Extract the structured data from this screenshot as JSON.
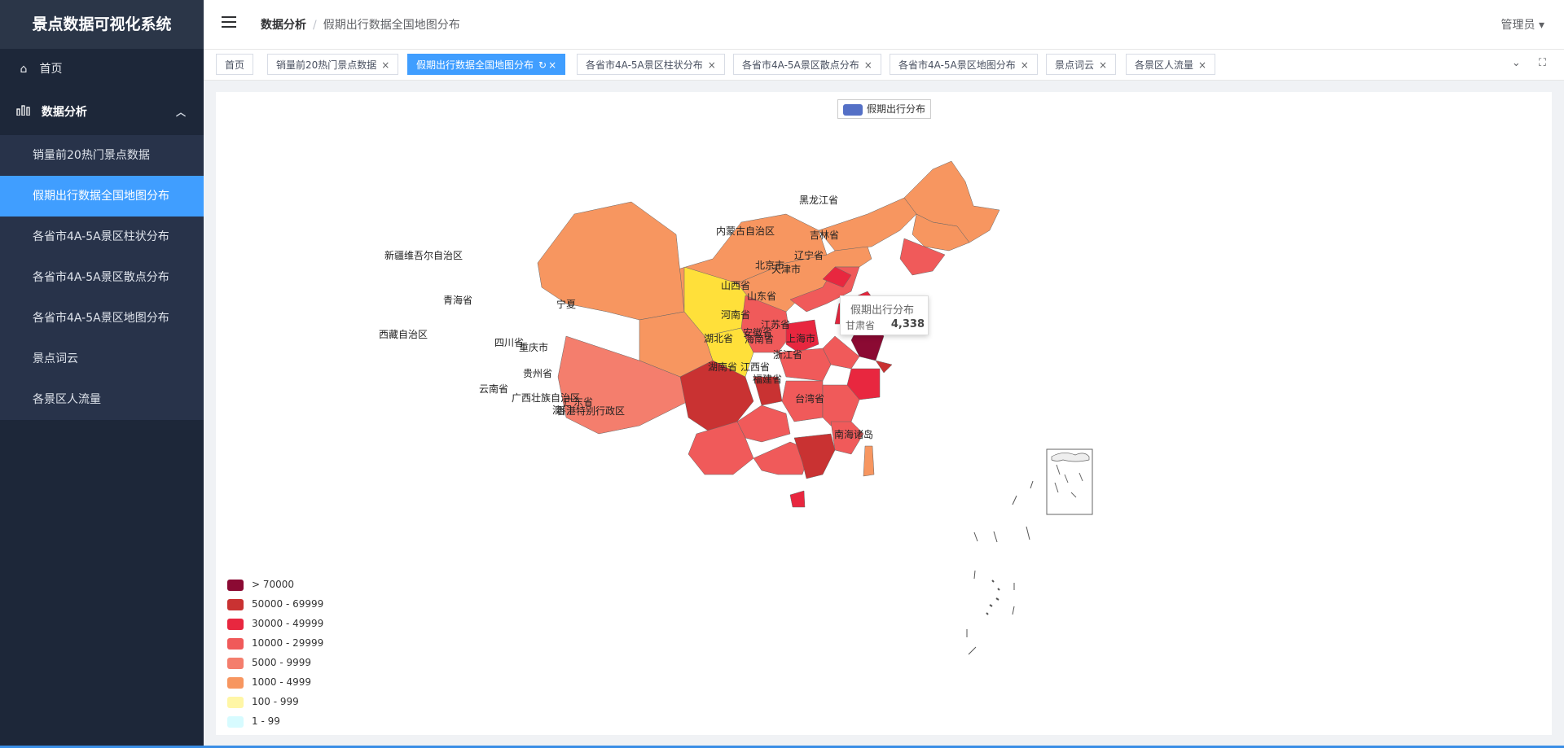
{
  "app": {
    "title": "景点数据可视化系统"
  },
  "sidebar": {
    "home": "首页",
    "group": "数据分析",
    "items": [
      {
        "label": "销量前20热门景点数据"
      },
      {
        "label": "假期出行数据全国地图分布"
      },
      {
        "label": "各省市4A-5A景区柱状分布"
      },
      {
        "label": "各省市4A-5A景区散点分布"
      },
      {
        "label": "各省市4A-5A景区地图分布"
      },
      {
        "label": "景点词云"
      },
      {
        "label": "各景区人流量"
      }
    ]
  },
  "header": {
    "breadcrumb_1": "数据分析",
    "breadcrumb_2": "假期出行数据全国地图分布",
    "user": "管理员"
  },
  "tags": [
    {
      "label": "首页"
    },
    {
      "label": "销量前20热门景点数据"
    },
    {
      "label": "假期出行数据全国地图分布"
    },
    {
      "label": "各省市4A-5A景区柱状分布"
    },
    {
      "label": "各省市4A-5A景区散点分布"
    },
    {
      "label": "各省市4A-5A景区地图分布"
    },
    {
      "label": "景点词云"
    },
    {
      "label": "各景区人流量"
    }
  ],
  "chart_data": {
    "type": "map",
    "legend": [
      "假期出行分布"
    ],
    "visual_map": [
      {
        "label": "> 70000",
        "color": "#8b0a33"
      },
      {
        "label": "50000 - 69999",
        "color": "#c93232"
      },
      {
        "label": "30000 - 49999",
        "color": "#e8273f"
      },
      {
        "label": "10000 - 29999",
        "color": "#f05a5a"
      },
      {
        "label": "5000 - 9999",
        "color": "#f47e6d"
      },
      {
        "label": "1000 - 4999",
        "color": "#f79660"
      },
      {
        "label": "100 - 999",
        "color": "#fff6a6"
      },
      {
        "label": "1 - 99",
        "color": "#d7fbff"
      }
    ],
    "tooltip": {
      "series": "假期出行分布",
      "name": "甘肃省",
      "value": "4,338"
    },
    "region_labels": [
      "黑龙江省",
      "内蒙古自治区",
      "吉林省",
      "辽宁省",
      "北京市",
      "天津市",
      "新疆维吾尔自治区",
      "山西省",
      "山东省",
      "青海省",
      "宁夏",
      "河南省",
      "江苏省",
      "安徽省",
      "上海市",
      "西藏自治区",
      "四川省",
      "湖北省",
      "重庆市",
      "浙江省",
      "湖南省",
      "江西省",
      "贵州省",
      "福建省",
      "云南省",
      "广西壮族自治区",
      "广东省",
      "台湾省",
      "香港特别行政区",
      "澳门",
      "海南省",
      "南海诸岛"
    ]
  }
}
